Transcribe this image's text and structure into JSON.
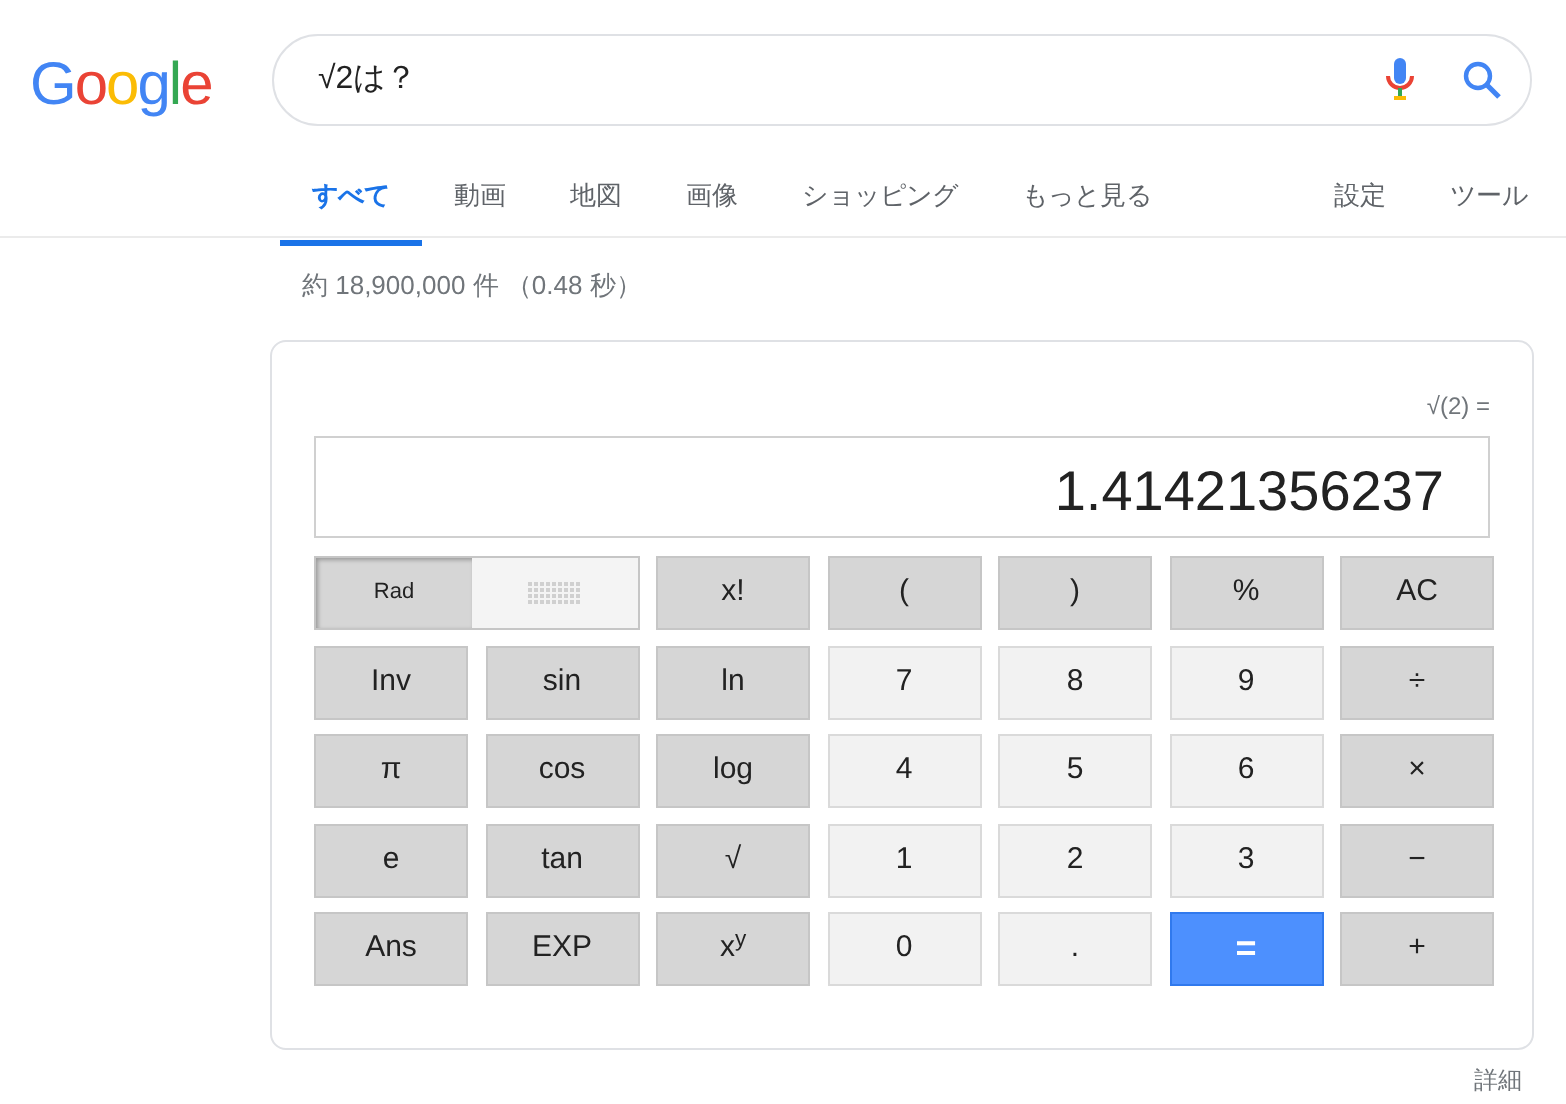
{
  "logo": "Google",
  "search": {
    "value": "√2は？"
  },
  "tabs": [
    {
      "label": "すべて",
      "selected": true
    },
    {
      "label": "動画",
      "selected": false
    },
    {
      "label": "地図",
      "selected": false
    },
    {
      "label": "画像",
      "selected": false
    },
    {
      "label": "ショッピング",
      "selected": false
    },
    {
      "label": "もっと見る",
      "selected": false
    }
  ],
  "tools": [
    "設定",
    "ツール"
  ],
  "result_stats": "約 18,900,000 件 （0.48 秒）",
  "calculator": {
    "expression": "√(2) =",
    "display": "1.41421356237",
    "angle_toggle": {
      "label": "Rad",
      "selected": true
    },
    "keys": [
      {
        "label": "x!",
        "kind": "func"
      },
      {
        "label": "(",
        "kind": "func"
      },
      {
        "label": ")",
        "kind": "func"
      },
      {
        "label": "%",
        "kind": "func"
      },
      {
        "label": "AC",
        "kind": "func"
      },
      {
        "label": "Inv",
        "kind": "func"
      },
      {
        "label": "sin",
        "kind": "func"
      },
      {
        "label": "ln",
        "kind": "func"
      },
      {
        "label": "7",
        "kind": "digit"
      },
      {
        "label": "8",
        "kind": "digit"
      },
      {
        "label": "9",
        "kind": "digit"
      },
      {
        "label": "÷",
        "kind": "func"
      },
      {
        "label": "π",
        "kind": "func"
      },
      {
        "label": "cos",
        "kind": "func"
      },
      {
        "label": "log",
        "kind": "func"
      },
      {
        "label": "4",
        "kind": "digit"
      },
      {
        "label": "5",
        "kind": "digit"
      },
      {
        "label": "6",
        "kind": "digit"
      },
      {
        "label": "×",
        "kind": "func"
      },
      {
        "label": "e",
        "kind": "func"
      },
      {
        "label": "tan",
        "kind": "func"
      },
      {
        "label": "√",
        "kind": "func"
      },
      {
        "label": "1",
        "kind": "digit"
      },
      {
        "label": "2",
        "kind": "digit"
      },
      {
        "label": "3",
        "kind": "digit"
      },
      {
        "label": "−",
        "kind": "func"
      },
      {
        "label": "Ans",
        "kind": "func"
      },
      {
        "label": "EXP",
        "kind": "func"
      },
      {
        "label": "x$^{y}$",
        "kind": "func"
      },
      {
        "label": "0",
        "kind": "digit"
      },
      {
        "label": ".",
        "kind": "digit"
      },
      {
        "label": "=",
        "kind": "equals"
      },
      {
        "label": "+",
        "kind": "func"
      }
    ]
  },
  "details_link": "詳細"
}
